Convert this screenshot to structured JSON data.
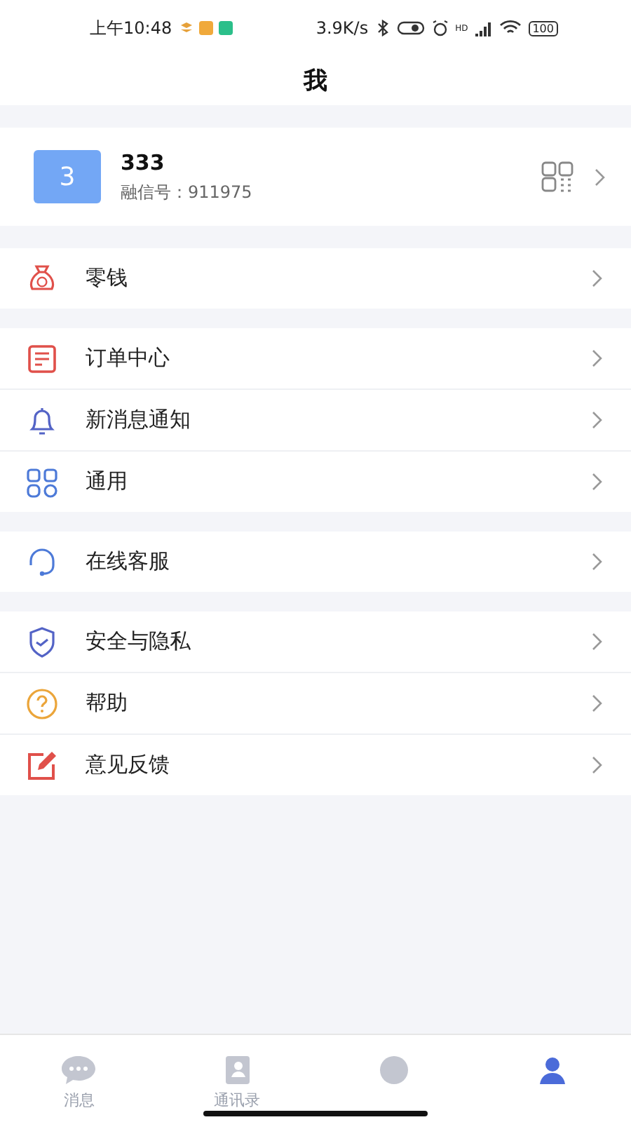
{
  "status_bar": {
    "time": "上午10:48",
    "speed": "3.9K/s",
    "signal_label": "HD",
    "battery": "100"
  },
  "title": "我",
  "profile": {
    "avatar": "3",
    "name": "333",
    "account": "融信号：911975"
  },
  "menu_groups": [
    {
      "items": [
        {
          "label": "零钱"
        }
      ]
    },
    {
      "items": [
        {
          "label": "订单中心"
        },
        {
          "label": "新消息通知"
        },
        {
          "label": "通用"
        }
      ]
    },
    {
      "items": [
        {
          "label": "在线客服"
        }
      ]
    },
    {
      "items": [
        {
          "label": "安全与隐私"
        },
        {
          "label": "帮助"
        },
        {
          "label": "意见反馈"
        }
      ]
    }
  ],
  "tab_bar": [
    {
      "label": "消息",
      "selected": false
    },
    {
      "label": "通讯录",
      "selected": false
    },
    {
      "selected": false
    },
    {
      "selected": true
    }
  ]
}
